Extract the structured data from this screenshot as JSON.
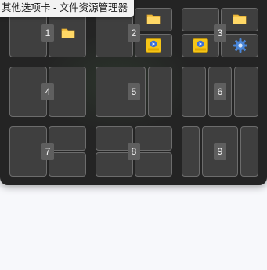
{
  "tooltip": {
    "text": "其他选项卡 - 文件资源管理器"
  },
  "layouts": [
    {
      "number": "1"
    },
    {
      "number": "2"
    },
    {
      "number": "3"
    },
    {
      "number": "4"
    },
    {
      "number": "5"
    },
    {
      "number": "6"
    },
    {
      "number": "7"
    },
    {
      "number": "8"
    },
    {
      "number": "9"
    }
  ],
  "icons": {
    "folder": "folder-icon",
    "player": "player-icon",
    "settings": "settings-gear-icon",
    "player_label": "Player"
  },
  "colors": {
    "panel": "#242424",
    "zone": "#3f3f3f",
    "zone_border": "#6c6c6c",
    "folder": "#f6c445",
    "player": "#f5c518",
    "gear": "#3a7bd5"
  }
}
